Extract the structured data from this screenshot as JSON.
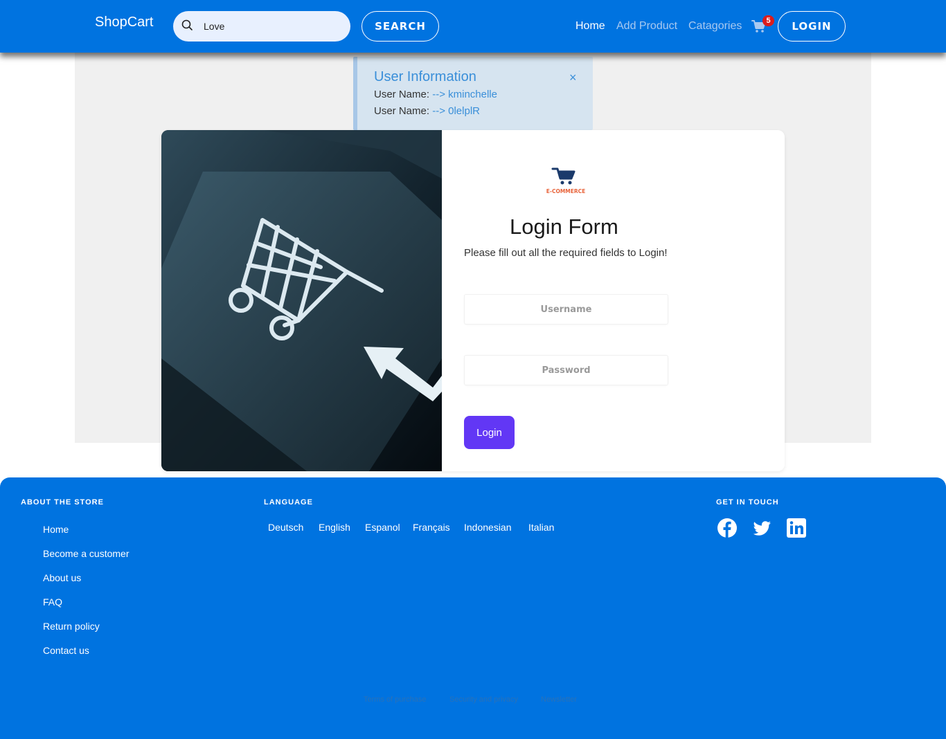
{
  "navbar": {
    "brand": "ShopCart",
    "search_value": "Love",
    "search_button": "SEARCH",
    "links": [
      "Home",
      "Add Product",
      "Catagories"
    ],
    "cart_count": "5",
    "cart_icon": "cart-icon",
    "login_button": "LOGIN"
  },
  "alert": {
    "title": "User Information",
    "close": "×",
    "lines": [
      {
        "label": "User Name:",
        "value": "--> kminchelle"
      },
      {
        "label": "User Name:",
        "value": "--> 0lelplR"
      }
    ]
  },
  "login": {
    "logo_text": "E-COMMERCE",
    "title": "Login Form",
    "subtitle": "Please fill out all the required fields to Login!",
    "username_placeholder": "Username",
    "password_placeholder": "Password",
    "button": "Login"
  },
  "footer": {
    "about": {
      "heading": "ABOUT THE STORE",
      "items": [
        "Home",
        "Become a customer",
        "About us",
        "FAQ",
        "Return policy",
        "Contact us"
      ]
    },
    "language": {
      "heading": "LANGUAGE",
      "items": [
        "Deutsch",
        "English",
        "Espanol",
        "Français",
        "Indonesian",
        "Italian"
      ]
    },
    "touch": {
      "heading": "GET IN TOUCH",
      "icons": [
        "facebook-icon",
        "twitter-icon",
        "linkedin-icon"
      ]
    },
    "bottom_links": [
      "Terms of purchase",
      "Security and privacy",
      "Newsletter"
    ]
  },
  "colors": {
    "primary": "#0073e0",
    "login_button": "#6237f5",
    "badge": "#dc1c1c",
    "alert_bg": "#d6e4f0",
    "alert_accent": "#3a8fd9"
  }
}
